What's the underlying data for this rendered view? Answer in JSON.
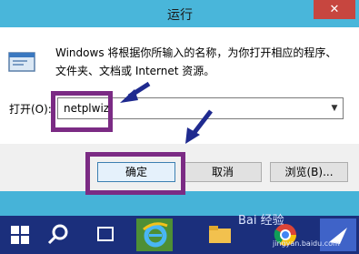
{
  "window": {
    "title": "运行",
    "close_glyph": "✕"
  },
  "dialog": {
    "description": "Windows 将根据你所输入的名称，为你打开相应的程序、文件夹、文档或 Internet 资源。",
    "open_label": "打开(O):",
    "input_value": "netplwiz",
    "dropdown_icon": "chevron-down-icon"
  },
  "buttons": {
    "ok": "确定",
    "cancel": "取消",
    "browse": "浏览(B)..."
  },
  "taskbar": {
    "icons": [
      "windows-start-icon",
      "search-icon",
      "task-view-icon",
      "ie-icon",
      "file-explorer-icon",
      "chrome-icon",
      "app-icon"
    ]
  },
  "watermark": {
    "brand": "Bai 经验",
    "url": "jingyan.baidu.com"
  },
  "colors": {
    "highlight": "#7b2b84",
    "arrow": "#1f2a8f",
    "taskbar": "#1b2f7c",
    "titlebar": "#49b6da"
  }
}
